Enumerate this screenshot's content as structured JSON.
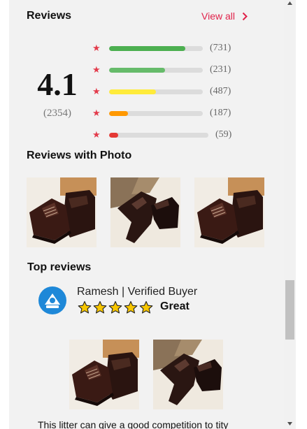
{
  "reviews": {
    "title": "Reviews",
    "view_all": "View all",
    "average": "4.1",
    "total": "(2354)",
    "bars": [
      {
        "count": "(731)",
        "fraction": 0.81,
        "color": "#4caf50"
      },
      {
        "count": "(231)",
        "fraction": 0.6,
        "color": "#66bb6a"
      },
      {
        "count": "(487)",
        "fraction": 0.5,
        "color": "#ffeb3b"
      },
      {
        "count": "(187)",
        "fraction": 0.2,
        "color": "#ff9800"
      },
      {
        "count": "(59)",
        "fraction": 0.09,
        "color": "#e53935"
      }
    ]
  },
  "photos": {
    "title": "Reviews with Photo"
  },
  "top_reviews": {
    "title": "Top reviews",
    "reviewer": "Ramesh | Verified Buyer",
    "stars": 5,
    "headline": "Great",
    "text": "This litter can give a good competition to tity"
  },
  "colors": {
    "accent": "#e0224a",
    "star": "#e33b4b",
    "avatar": "#1e88d8",
    "gold_star": "#f7c600"
  },
  "icons": [
    "chevron-right-icon",
    "star-icon",
    "user-avatar-icon",
    "scroll-up-icon",
    "scroll-down-icon"
  ]
}
